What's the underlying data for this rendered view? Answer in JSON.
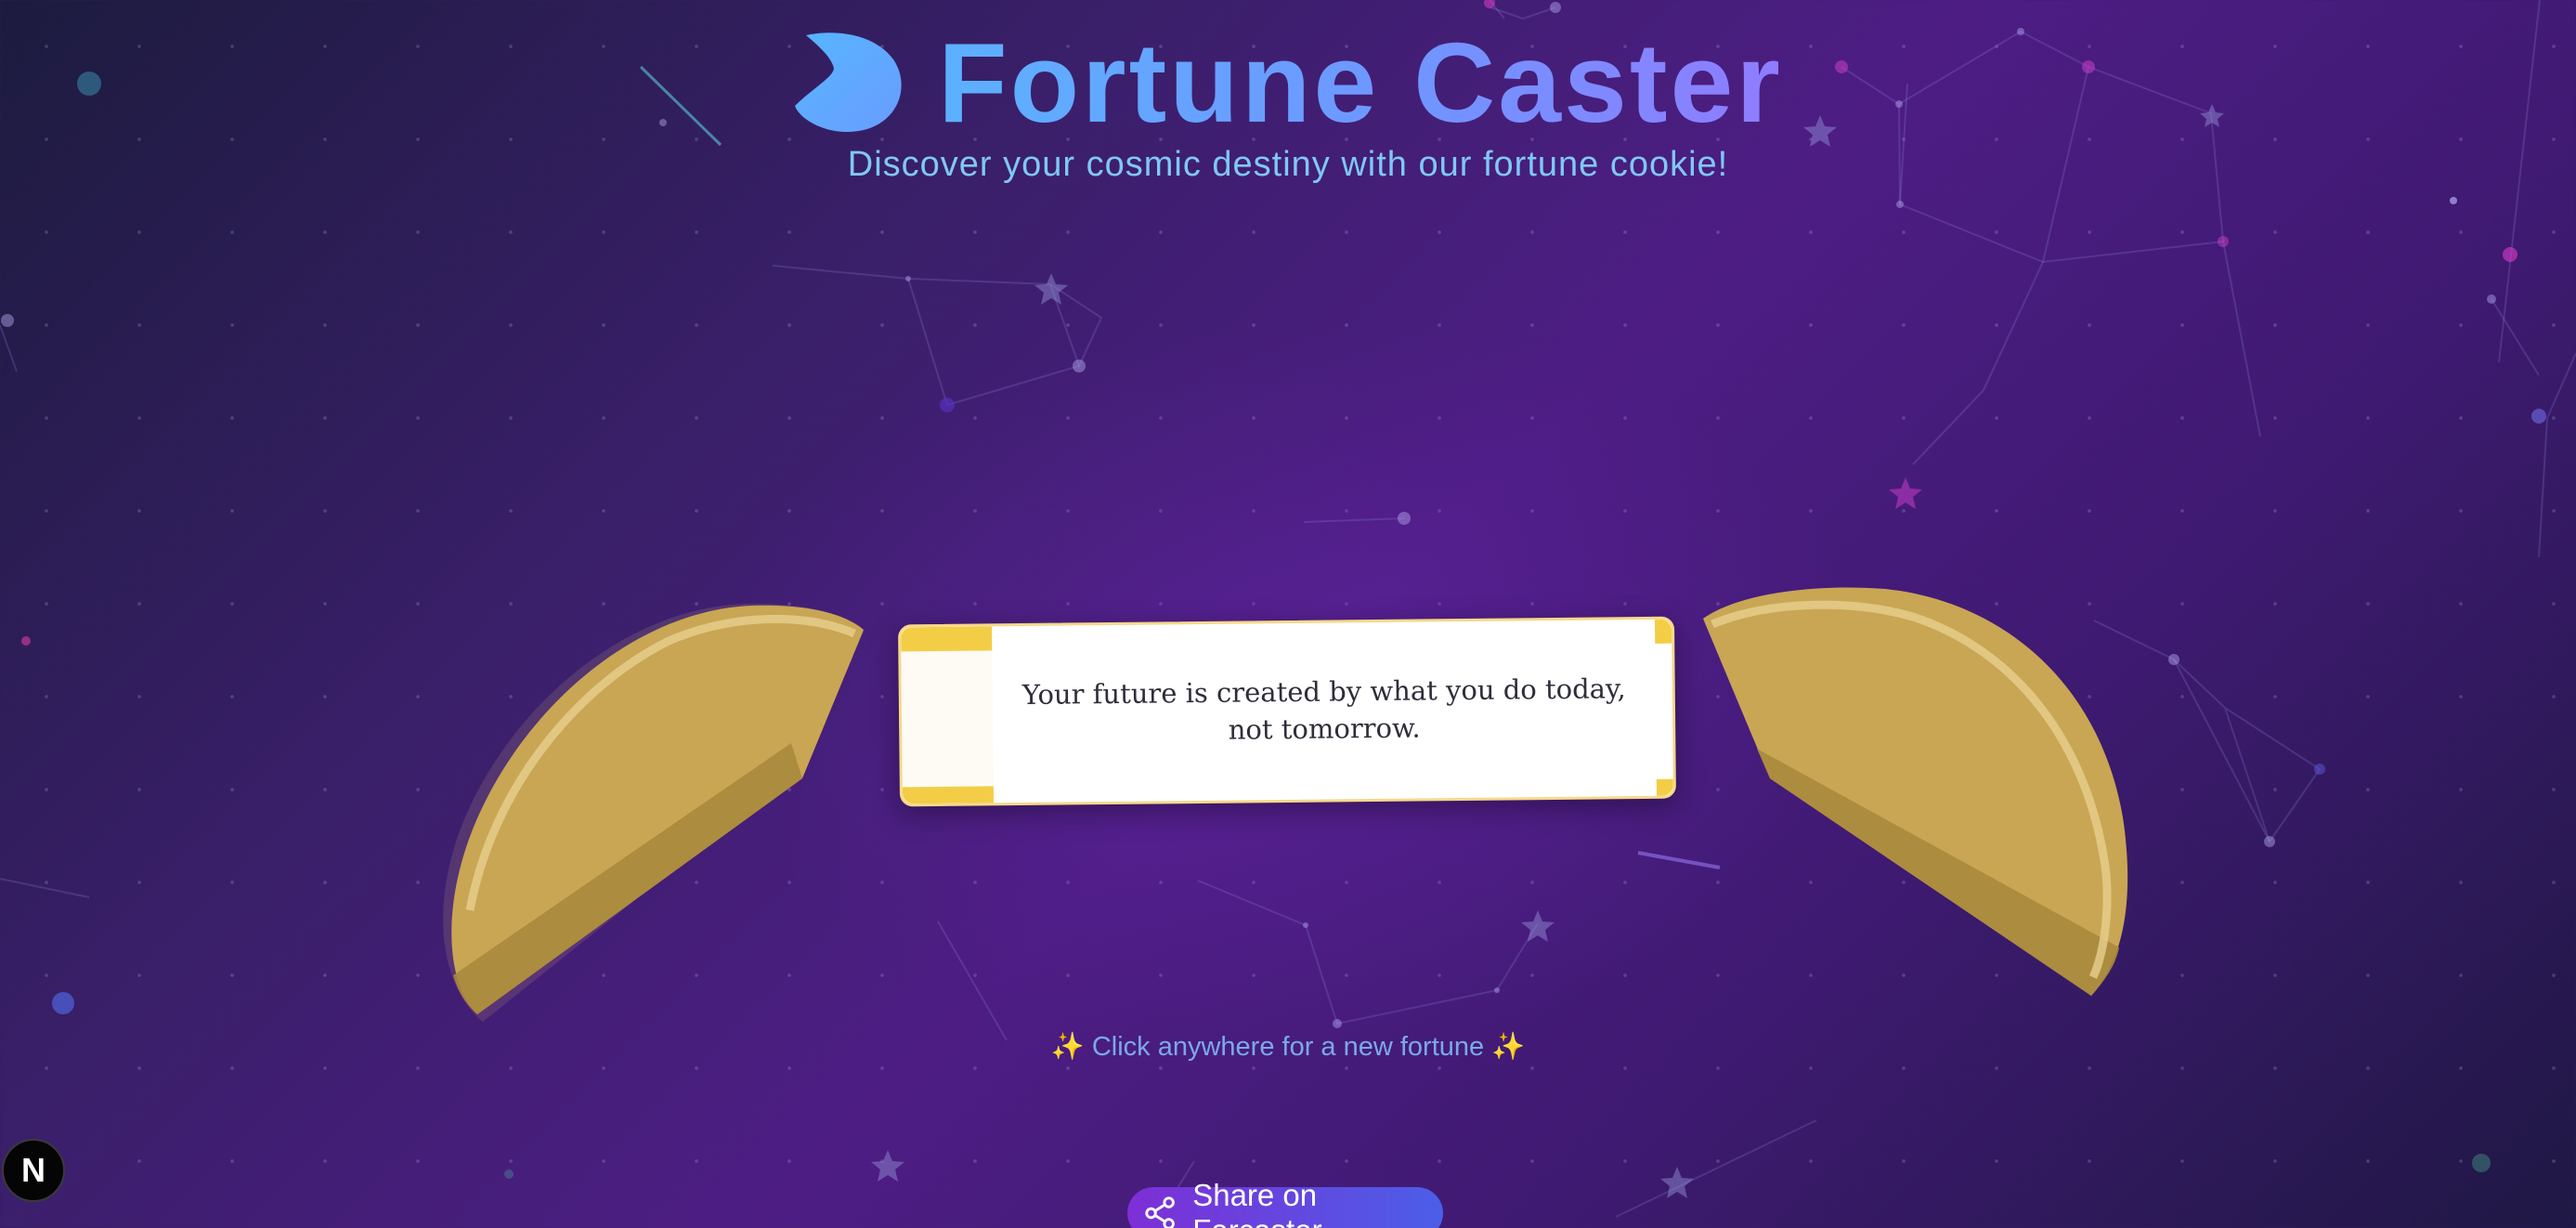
{
  "header": {
    "title": "Fortune Caster",
    "subtitle": "Discover your cosmic destiny with our fortune cookie!",
    "logo_icon": "moon-cookie-icon"
  },
  "fortune": {
    "text": "Your future is created by what you do today, not tomorrow."
  },
  "hint": "✨ Click anywhere for a new fortune ✨",
  "share": {
    "label": "Share on Farcaster",
    "icon": "share-icon"
  },
  "badge": {
    "letter": "N"
  },
  "colors": {
    "title_gradient_start": "#5cb1ff",
    "title_gradient_end": "#8f7cff",
    "subtitle": "#7fc8f4",
    "cookie": "#c9a653",
    "paper_accent": "#f3cd45",
    "share_gradient_start": "#7d2fd6",
    "share_gradient_end": "#4b5ee8"
  }
}
